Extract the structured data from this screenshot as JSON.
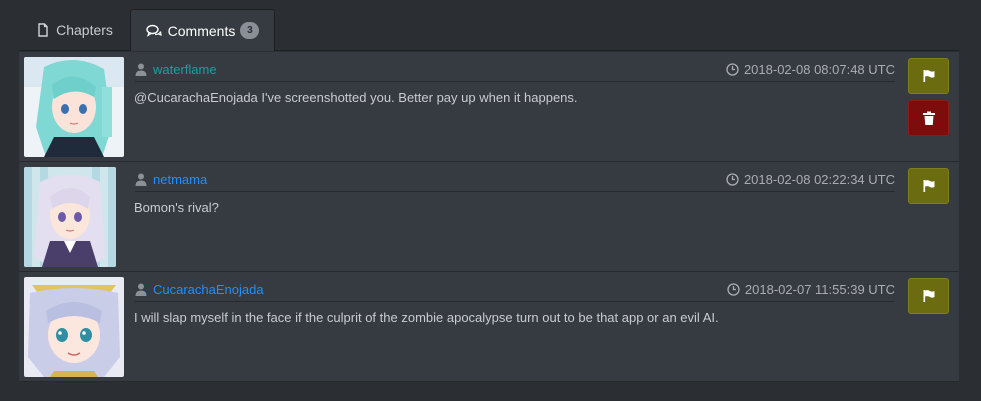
{
  "tabs": [
    {
      "label": "Chapters",
      "icon": "document-icon",
      "active": false
    },
    {
      "label": "Comments",
      "icon": "comments-icon",
      "active": true,
      "count": "3"
    }
  ],
  "colors": {
    "username_teal": "#17a2a2",
    "username_blue": "#1e90ff",
    "flag_button": "#6b6b0f",
    "delete_button": "#7d0d0d"
  },
  "comments": [
    {
      "username": "waterflame",
      "timestamp": "2018-02-08 08:07:48 UTC",
      "text": "@CucarachaEnojada I've screenshotted you. Better pay up when it happens.",
      "actions": [
        "flag",
        "delete"
      ]
    },
    {
      "username": "netmama",
      "timestamp": "2018-02-08 02:22:34 UTC",
      "text": "Bomon's rival?",
      "actions": [
        "flag"
      ]
    },
    {
      "username": "CucarachaEnojada",
      "timestamp": "2018-02-07 11:55:39 UTC",
      "text": "I will slap myself in the face if the culprit of the zombie apocalypse turn out to be that app or an evil AI.",
      "actions": [
        "flag"
      ]
    }
  ]
}
